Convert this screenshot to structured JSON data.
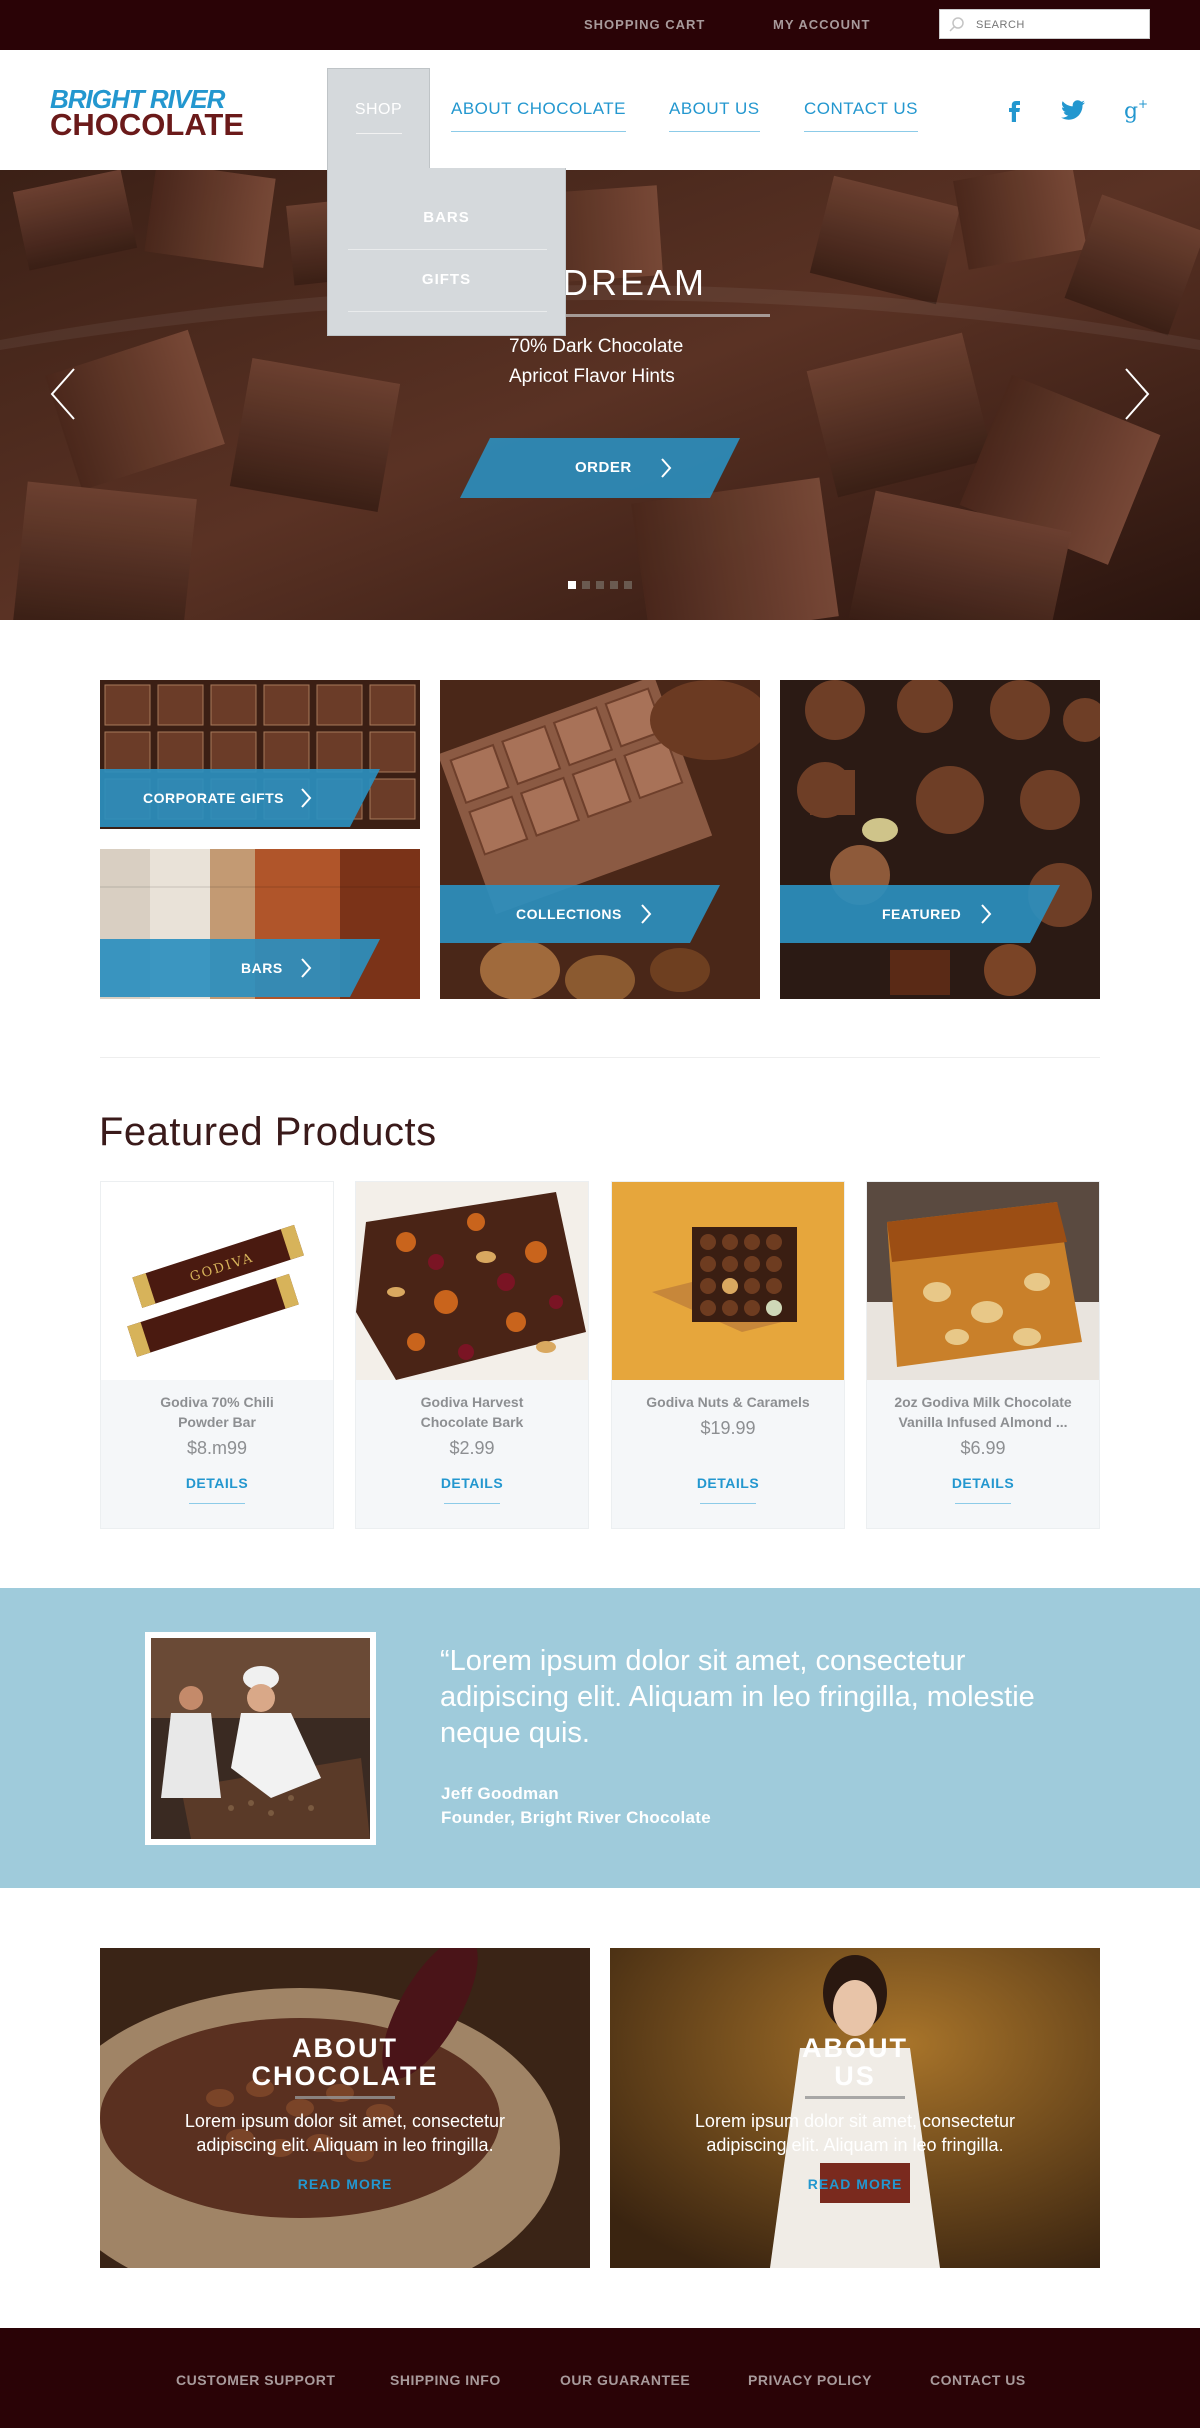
{
  "topbar": {
    "shopping_cart": "SHOPPING CART",
    "my_account": "MY ACCOUNT",
    "search_placeholder": "SEARCH"
  },
  "logo": {
    "line1": "BRIGHT RIVER",
    "line2": "CHOCOLATE"
  },
  "nav": {
    "shop": "SHOP",
    "about_chocolate": "ABOUT CHOCOLATE",
    "about_us": "ABOUT US",
    "contact_us": "CONTACT US"
  },
  "social": {
    "facebook": "facebook-icon",
    "twitter": "twitter-icon",
    "googleplus": "google-plus-icon"
  },
  "dropdown": {
    "items": [
      "BARS",
      "GIFTS"
    ]
  },
  "hero": {
    "title": "AN DREAM",
    "line1": "70% Dark Chocolate",
    "line2": "Apricot Flavor Hints",
    "order_label": "ORDER",
    "slide_count": 5,
    "active_slide": 1
  },
  "categories": {
    "corporate_gifts": "CORPORATE GIFTS",
    "bars": "BARS",
    "collections": "COLLECTIONS",
    "featured": "FEATURED"
  },
  "featured": {
    "title": "Featured Products",
    "products": [
      {
        "name_line1": "Godiva 70% Chili",
        "name_line2": "Powder Bar",
        "price": "$8.m99",
        "details": "DETAILS"
      },
      {
        "name_line1": "Godiva Harvest",
        "name_line2": "Chocolate Bark",
        "price": "$2.99",
        "details": "DETAILS"
      },
      {
        "name_line1": "Godiva Nuts & Caramels",
        "name_line2": "",
        "price": "$19.99",
        "details": "DETAILS"
      },
      {
        "name_line1": "2oz Godiva Milk Chocolate",
        "name_line2": "Vanilla Infused Almond ...",
        "price": "$6.99",
        "details": "DETAILS"
      }
    ]
  },
  "testimonial": {
    "quote": "“Lorem ipsum dolor sit amet, consectetur adipiscing elit. Aliquam in leo fringilla, molestie neque quis.",
    "author": "Jeff Goodman",
    "role": "Founder, Bright River Chocolate"
  },
  "about_chocolate": {
    "heading1": "ABOUT",
    "heading2": "CHOCOLATE",
    "body": "Lorem ipsum dolor sit amet, consectetur adipiscing elit. Aliquam in leo fringilla.",
    "read_more": "READ MORE"
  },
  "about_us": {
    "heading1": "ABOUT",
    "heading2": "US",
    "body": "Lorem ipsum dolor sit amet, consectetur adipiscing elit. Aliquam in leo fringilla.",
    "read_more": "READ MORE"
  },
  "footer": {
    "customer_support": "CUSTOMER SUPPORT",
    "shipping_info": "SHIPPING INFO",
    "our_guarantee": "OUR GUARANTEE",
    "privacy_policy": "PRIVACY POLICY",
    "contact_us": "CONTACT US"
  },
  "colors": {
    "brand_dark": "#2a0306",
    "accent_blue": "#2397cf",
    "testimonial_bg": "#9fcbdb",
    "dropdown_bg": "#d5d9dc"
  }
}
